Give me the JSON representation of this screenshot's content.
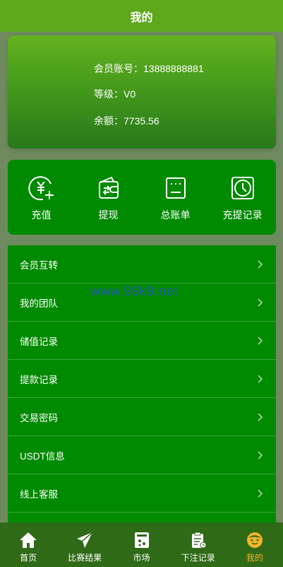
{
  "header": {
    "title": "我的"
  },
  "account": {
    "member_label": "会员账号：",
    "member_value": "13888888881",
    "level_label": "等级：",
    "level_value": "V0",
    "balance_label": "余额：",
    "balance_value": "7735.56"
  },
  "actions": [
    {
      "label": "充值",
      "icon": "recharge-icon"
    },
    {
      "label": "提现",
      "icon": "wallet-icon"
    },
    {
      "label": "总账单",
      "icon": "bill-icon"
    },
    {
      "label": "充提记录",
      "icon": "clock-icon"
    }
  ],
  "menu": [
    {
      "label": "会员互转"
    },
    {
      "label": "我的团队"
    },
    {
      "label": "储值记录"
    },
    {
      "label": "提款记录"
    },
    {
      "label": "交易密码"
    },
    {
      "label": "USDT信息"
    },
    {
      "label": "线上客服"
    }
  ],
  "watermark": "www.99k9.net",
  "tabbar": [
    {
      "label": "首页",
      "icon": "home-icon"
    },
    {
      "label": "比赛结果",
      "icon": "paper-plane-icon"
    },
    {
      "label": "市场",
      "icon": "market-icon"
    },
    {
      "label": "下注记录",
      "icon": "clipboard-icon"
    },
    {
      "label": "我的",
      "icon": "smiley-icon",
      "active": true
    }
  ],
  "colors": {
    "header": "#5ea81c",
    "card_green": "#008a00",
    "tabbar": "#2f6a17",
    "active_tab": "#f5b52b"
  }
}
